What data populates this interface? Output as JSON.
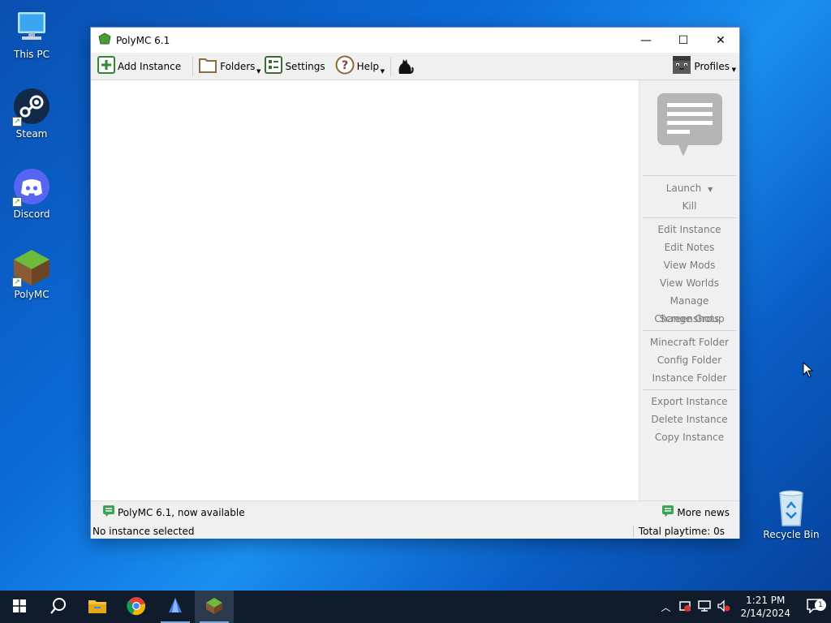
{
  "desktop": {
    "icons": [
      {
        "label": "This PC"
      },
      {
        "label": "Steam"
      },
      {
        "label": "Discord"
      },
      {
        "label": "PolyMC"
      },
      {
        "label": "Recycle Bin"
      }
    ]
  },
  "window": {
    "title": "PolyMC 6.1",
    "controls": {
      "minimize": "—",
      "maximize": "☐",
      "close": "✕"
    }
  },
  "toolbar": {
    "add_instance": "Add Instance",
    "folders": "Folders",
    "settings": "Settings",
    "help": "Help",
    "profiles": "Profiles"
  },
  "sidebar": {
    "launch": "Launch",
    "kill": "Kill",
    "groups": [
      [
        "Edit Instance",
        "Edit Notes",
        "View Mods",
        "View Worlds",
        "Manage Screenshots",
        "Change Group"
      ],
      [
        "Minecraft Folder",
        "Config Folder",
        "Instance Folder"
      ],
      [
        "Export Instance",
        "Delete Instance",
        "Copy Instance"
      ]
    ]
  },
  "news": {
    "headline": "PolyMC 6.1, now available",
    "more": "More news"
  },
  "status": {
    "left": "No instance selected",
    "right": "Total playtime: 0s"
  },
  "taskbar": {
    "time": "1:21 PM",
    "date": "2/14/2024",
    "notification_count": "1"
  },
  "colors": {
    "accent": "#0b6bd8",
    "taskbar": "#101c2c",
    "disabled_text": "#7a7a7a"
  }
}
